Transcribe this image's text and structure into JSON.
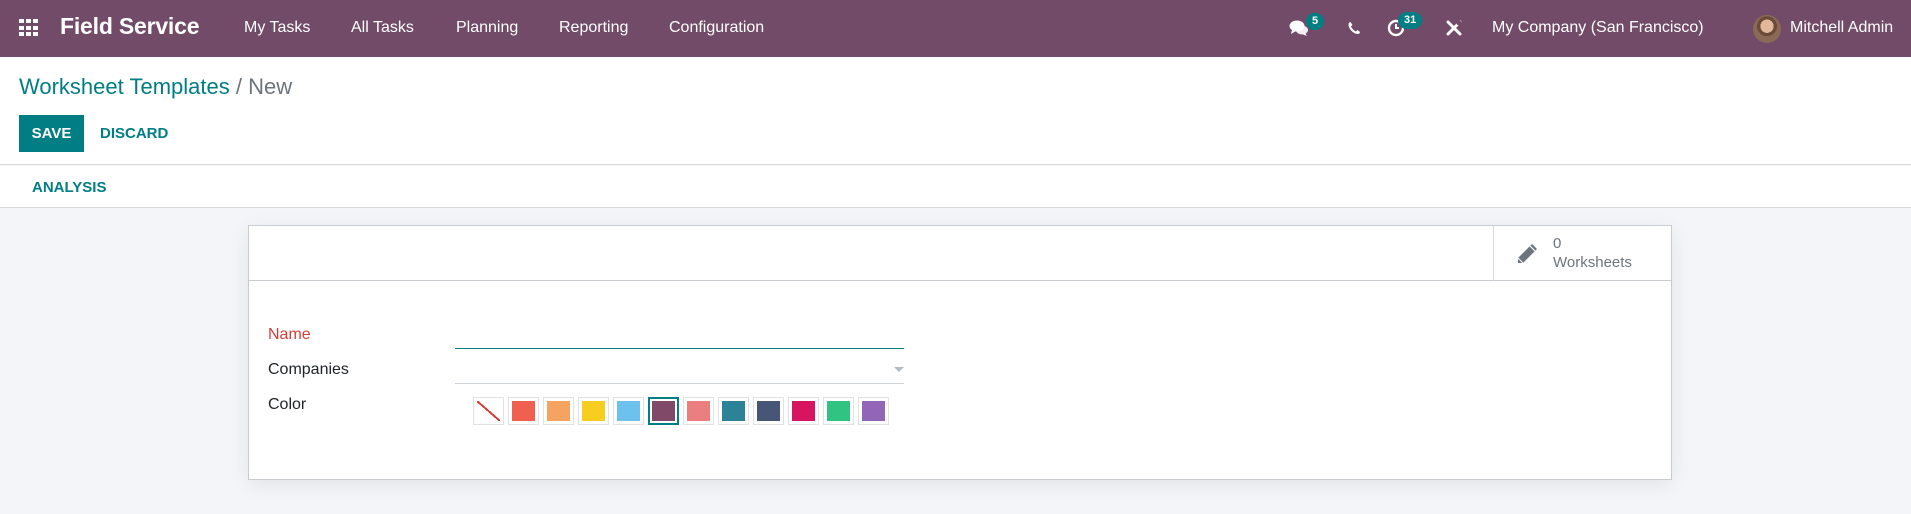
{
  "navbar": {
    "app_name": "Field Service",
    "menu": [
      "My Tasks",
      "All Tasks",
      "Planning",
      "Reporting",
      "Configuration"
    ],
    "messages_badge": "5",
    "activities_badge": "31",
    "company": "My Company (San Francisco)",
    "user": "Mitchell Admin",
    "background_color": "#714b67",
    "badge_color": "#017e84"
  },
  "breadcrumb": {
    "parent": "Worksheet Templates",
    "separator": "/",
    "current": "New"
  },
  "actions": {
    "save_label": "SAVE",
    "discard_label": "DISCARD"
  },
  "header": {
    "analysis_label": "ANALYSIS"
  },
  "stat_button": {
    "icon": "pencil-icon",
    "value": "0",
    "label": "Worksheets"
  },
  "form": {
    "name_label": "Name",
    "name_value": "",
    "companies_label": "Companies",
    "companies_value": "",
    "color_label": "Color",
    "colors": [
      {
        "name": "No color",
        "hex": "#ffffff"
      },
      {
        "name": "Red",
        "hex": "#f06050"
      },
      {
        "name": "Orange",
        "hex": "#f4a460"
      },
      {
        "name": "Yellow",
        "hex": "#f7cd1f"
      },
      {
        "name": "Light blue",
        "hex": "#6cc1ed"
      },
      {
        "name": "Dark purple",
        "hex": "#814968"
      },
      {
        "name": "Salmon pink",
        "hex": "#eb7e7f"
      },
      {
        "name": "Medium blue",
        "hex": "#2c8397"
      },
      {
        "name": "Dark blue",
        "hex": "#475577"
      },
      {
        "name": "Fuchsia",
        "hex": "#d6145f"
      },
      {
        "name": "Green",
        "hex": "#30c381"
      },
      {
        "name": "Purple",
        "hex": "#9365b8"
      }
    ],
    "selected_color_index": 5
  }
}
